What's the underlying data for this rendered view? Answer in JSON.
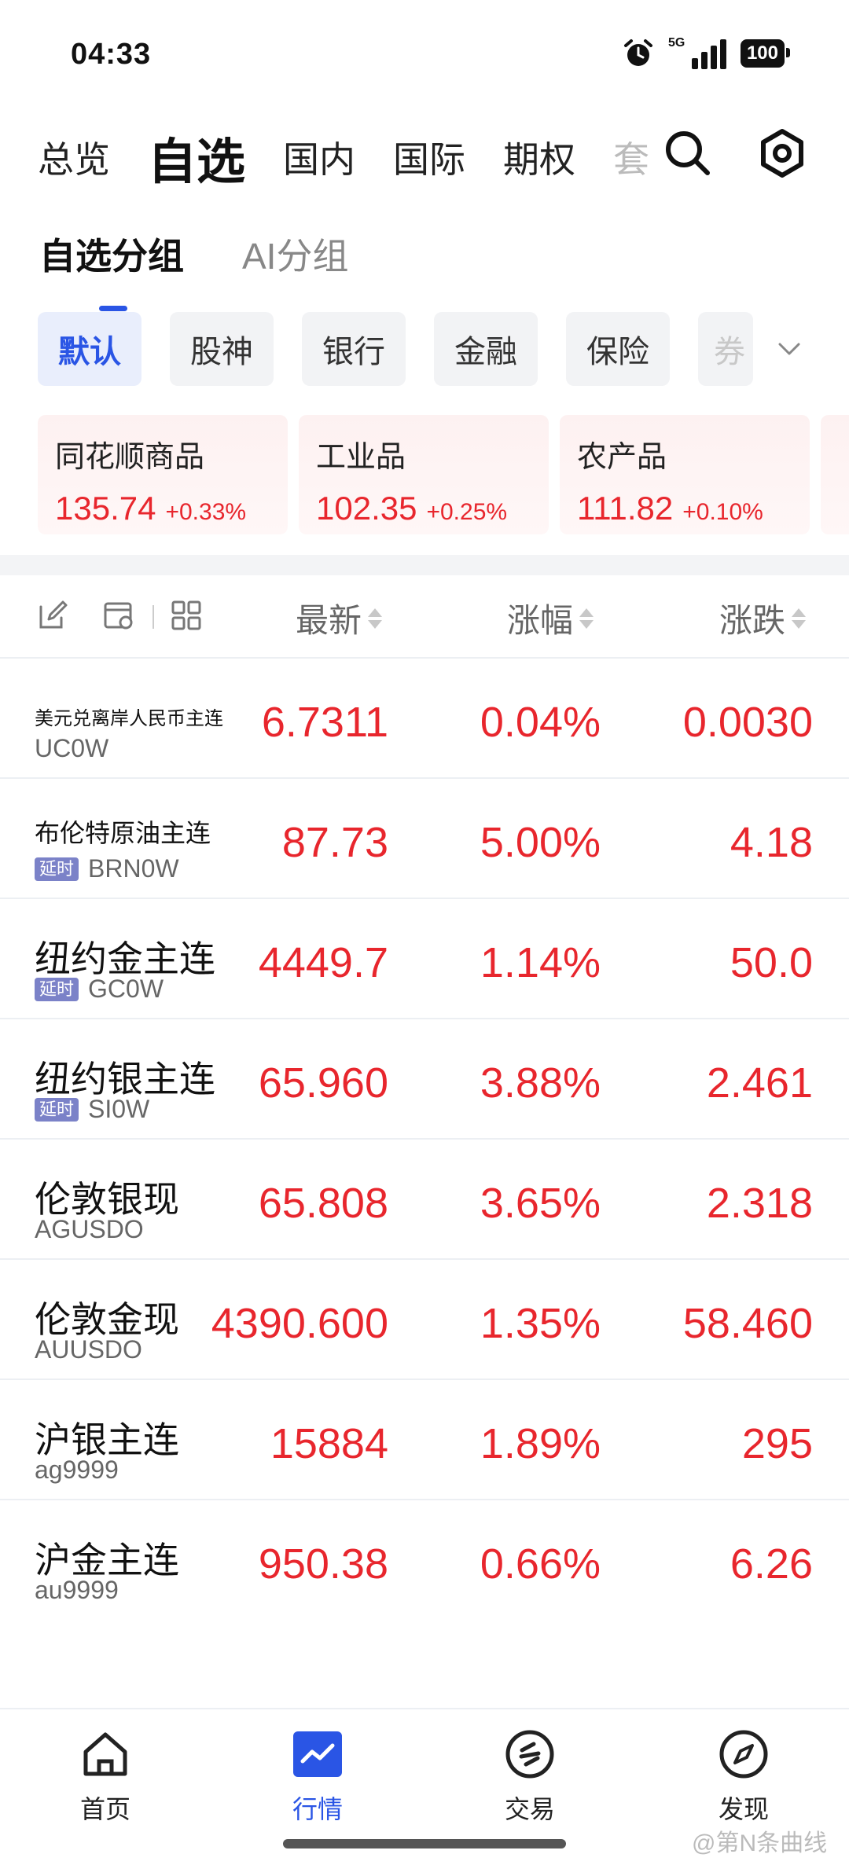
{
  "status": {
    "time": "04:33",
    "network": "5G",
    "battery": "100"
  },
  "top_tabs": [
    "总览",
    "自选",
    "国内",
    "国际",
    "期权",
    "套"
  ],
  "sub_tabs": [
    "自选分组",
    "AI分组"
  ],
  "chips": [
    "默认",
    "股神",
    "银行",
    "金融",
    "保险",
    "券"
  ],
  "cards": [
    {
      "name": "同花顺商品",
      "price": "135.74",
      "change": "+0.33%"
    },
    {
      "name": "工业品",
      "price": "102.35",
      "change": "+0.25%"
    },
    {
      "name": "农产品",
      "price": "111.82",
      "change": "+0.10%"
    }
  ],
  "table": {
    "headers": {
      "latest": "最新",
      "pct": "涨幅",
      "change": "涨跌"
    },
    "rows": [
      {
        "name": "美元兑离岸人民币主连",
        "code": "UC0W",
        "tag": "",
        "latest": "6.7311",
        "pct": "0.04%",
        "change": "0.0030"
      },
      {
        "name": "布伦特原油主连",
        "code": "BRN0W",
        "tag": "延时",
        "latest": "87.73",
        "pct": "5.00%",
        "change": "4.18"
      },
      {
        "name": "纽约金主连",
        "code": "GC0W",
        "tag": "延时",
        "latest": "4449.7",
        "pct": "1.14%",
        "change": "50.0"
      },
      {
        "name": "纽约银主连",
        "code": "SI0W",
        "tag": "延时",
        "latest": "65.960",
        "pct": "3.88%",
        "change": "2.461"
      },
      {
        "name": "伦敦银现",
        "code": "AGUSDO",
        "tag": "",
        "latest": "65.808",
        "pct": "3.65%",
        "change": "2.318"
      },
      {
        "name": "伦敦金现",
        "code": "AUUSDO",
        "tag": "",
        "latest": "4390.600",
        "pct": "1.35%",
        "change": "58.460"
      },
      {
        "name": "沪银主连",
        "code": "ag9999",
        "tag": "",
        "latest": "15884",
        "pct": "1.89%",
        "change": "295"
      },
      {
        "name": "沪金主连",
        "code": "au9999",
        "tag": "",
        "latest": "950.38",
        "pct": "0.66%",
        "change": "6.26"
      }
    ]
  },
  "bottom_nav": [
    "首页",
    "行情",
    "交易",
    "发现"
  ],
  "watermark": "@第N条曲线",
  "colors": {
    "accent": "#2a55e5",
    "up": "#e8262d",
    "tag": "#7b82c8"
  }
}
